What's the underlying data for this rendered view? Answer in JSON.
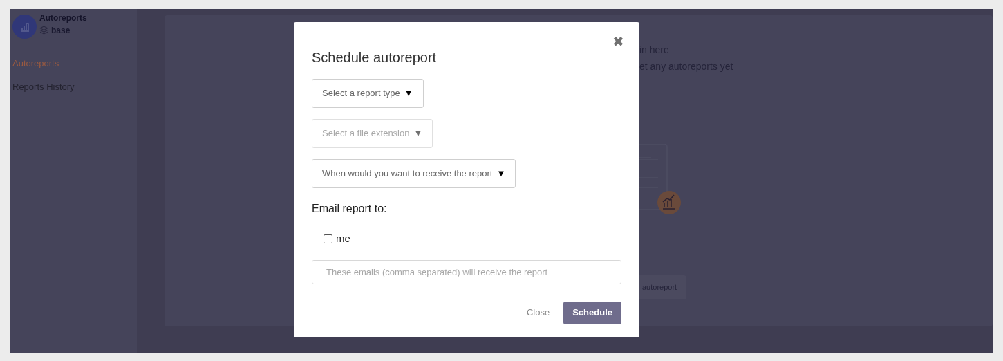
{
  "app": {
    "title": "Autoreports",
    "workspace": "base"
  },
  "sidebar": {
    "items": [
      {
        "label": "Autoreports",
        "selected": true
      },
      {
        "label": "Reports History",
        "selected": false
      }
    ]
  },
  "background": {
    "lines": [
      "in here",
      "et any autoreports yet"
    ],
    "button": "autoreport"
  },
  "modal": {
    "title": "Schedule autoreport",
    "close_symbol": "✖",
    "selects": [
      {
        "label": "Select a report type",
        "arrow": "▼",
        "disabled": false
      },
      {
        "label": "Select a file extension",
        "arrow": "▼",
        "disabled": true
      },
      {
        "label": "When would you want to receive the report",
        "arrow": "▼",
        "disabled": false
      }
    ],
    "email_label": "Email report to:",
    "me": {
      "label": "me",
      "checked": false
    },
    "emails": {
      "placeholder": "These emails (comma separated) will receive the report"
    },
    "buttons": {
      "close": "Close",
      "schedule": "Schedule"
    }
  }
}
